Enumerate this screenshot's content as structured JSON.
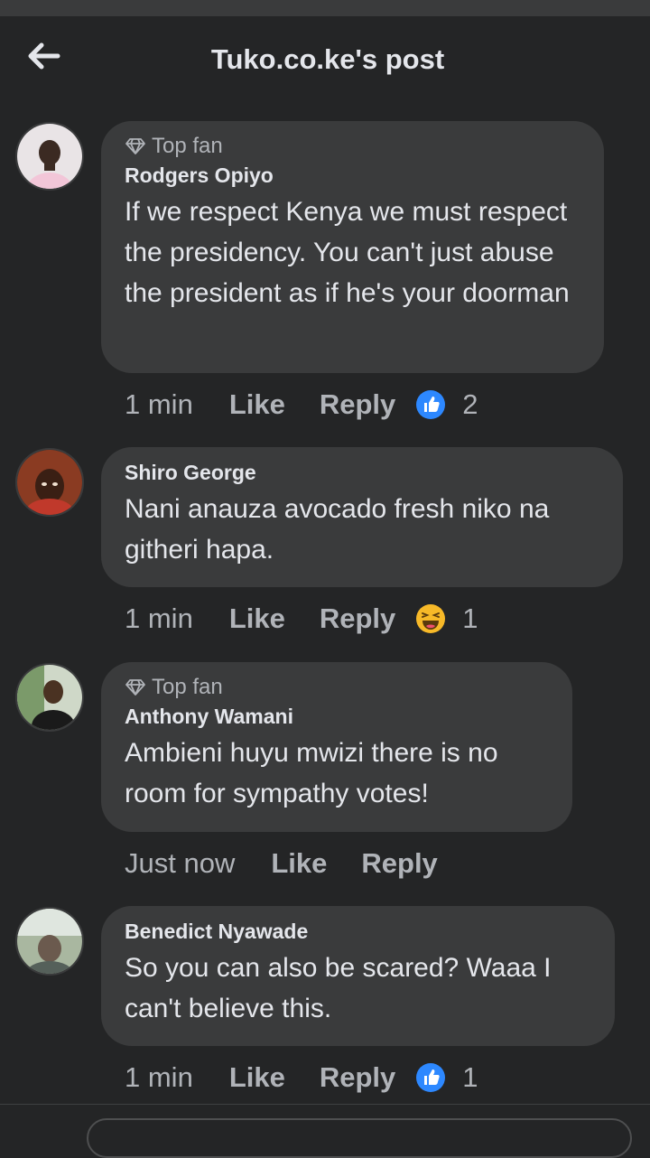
{
  "header": {
    "title": "Tuko.co.ke's post",
    "back_icon": "arrow-left-icon"
  },
  "colors": {
    "background": "#242526",
    "bubble": "#3a3b3c",
    "text": "#e4e6eb",
    "muted": "#b0b3b8",
    "like_blue": "#2d88ff",
    "haha_yellow": "#f7b928"
  },
  "comments": [
    {
      "badge": "Top fan",
      "author": "Rodgers Opiyo",
      "text": "If we respect Kenya we must respect the presidency. You can't just abuse the president as if he's your doorman",
      "time": "1 min",
      "like": "Like",
      "reply": "Reply",
      "reaction": "like",
      "reaction_count": "2"
    },
    {
      "author": "Shiro George",
      "text": "Nani anauza avocado fresh niko na githeri hapa.",
      "time": "1 min",
      "like": "Like",
      "reply": "Reply",
      "reaction": "haha",
      "reaction_count": "1"
    },
    {
      "badge": "Top fan",
      "author": "Anthony Wamani",
      "text": "Ambieni huyu mwizi there is no room for sympathy votes!",
      "time": "Just now",
      "like": "Like",
      "reply": "Reply"
    },
    {
      "author": "Benedict Nyawade",
      "text": "So you can also be scared? Waaa I can't believe this.",
      "time": "1 min",
      "like": "Like",
      "reply": "Reply",
      "reaction": "like",
      "reaction_count": "1"
    }
  ]
}
